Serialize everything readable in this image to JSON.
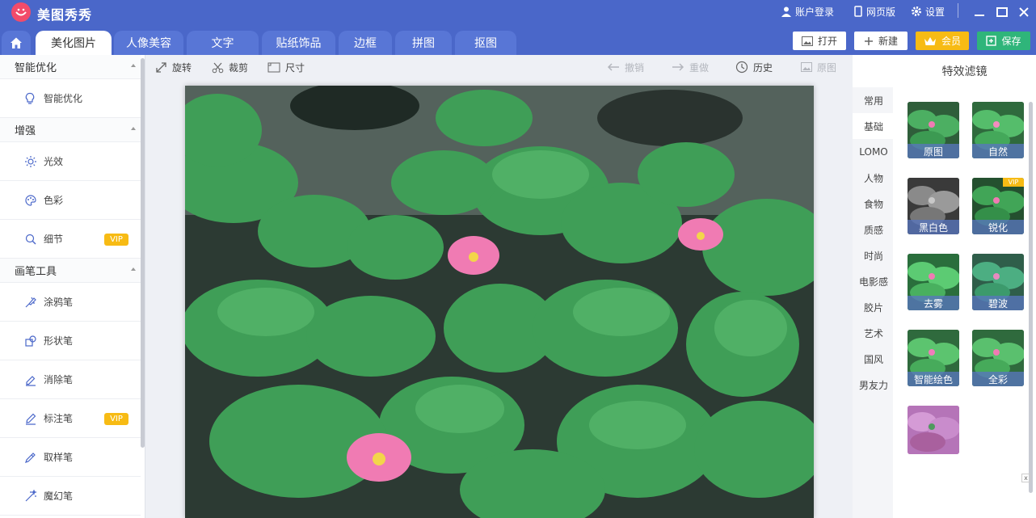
{
  "app": {
    "name": "美图秀秀"
  },
  "topbar": {
    "account": "账户登录",
    "web": "网页版",
    "settings": "设置"
  },
  "tabs": [
    "美化图片",
    "人像美容",
    "文字",
    "贴纸饰品",
    "边框",
    "拼图",
    "抠图"
  ],
  "header_buttons": {
    "open": "打开",
    "new": "新建",
    "vip": "会员",
    "save": "保存"
  },
  "sidebar": {
    "sections": [
      "智能优化",
      "增强",
      "画笔工具"
    ],
    "items": [
      "智能优化",
      "光效",
      "色彩",
      "细节",
      "涂鸦笔",
      "形状笔",
      "消除笔",
      "标注笔",
      "取样笔",
      "魔幻笔"
    ],
    "vip_label": "VIP"
  },
  "toolbar": {
    "rotate": "旋转",
    "crop": "裁剪",
    "size": "尺寸",
    "undo": "撤销",
    "redo": "重做",
    "history": "历史",
    "original": "原图"
  },
  "filters": {
    "title": "特效滤镜",
    "categories": [
      "常用",
      "基础",
      "LOMO",
      "人物",
      "食物",
      "质感",
      "时尚",
      "电影感",
      "胶片",
      "艺术",
      "国风",
      "男友力"
    ],
    "active_category": "基础",
    "items": [
      "原图",
      "自然",
      "黑白色",
      "锐化",
      "去雾",
      "碧波",
      "智能绘色",
      "全彩"
    ],
    "vip_label": "VIP"
  },
  "colors": {
    "brand": "#4a67c9",
    "tab": "#5876d6",
    "vip": "#f7bb14",
    "save": "#2fb57a",
    "logo": "#f24b6a"
  }
}
